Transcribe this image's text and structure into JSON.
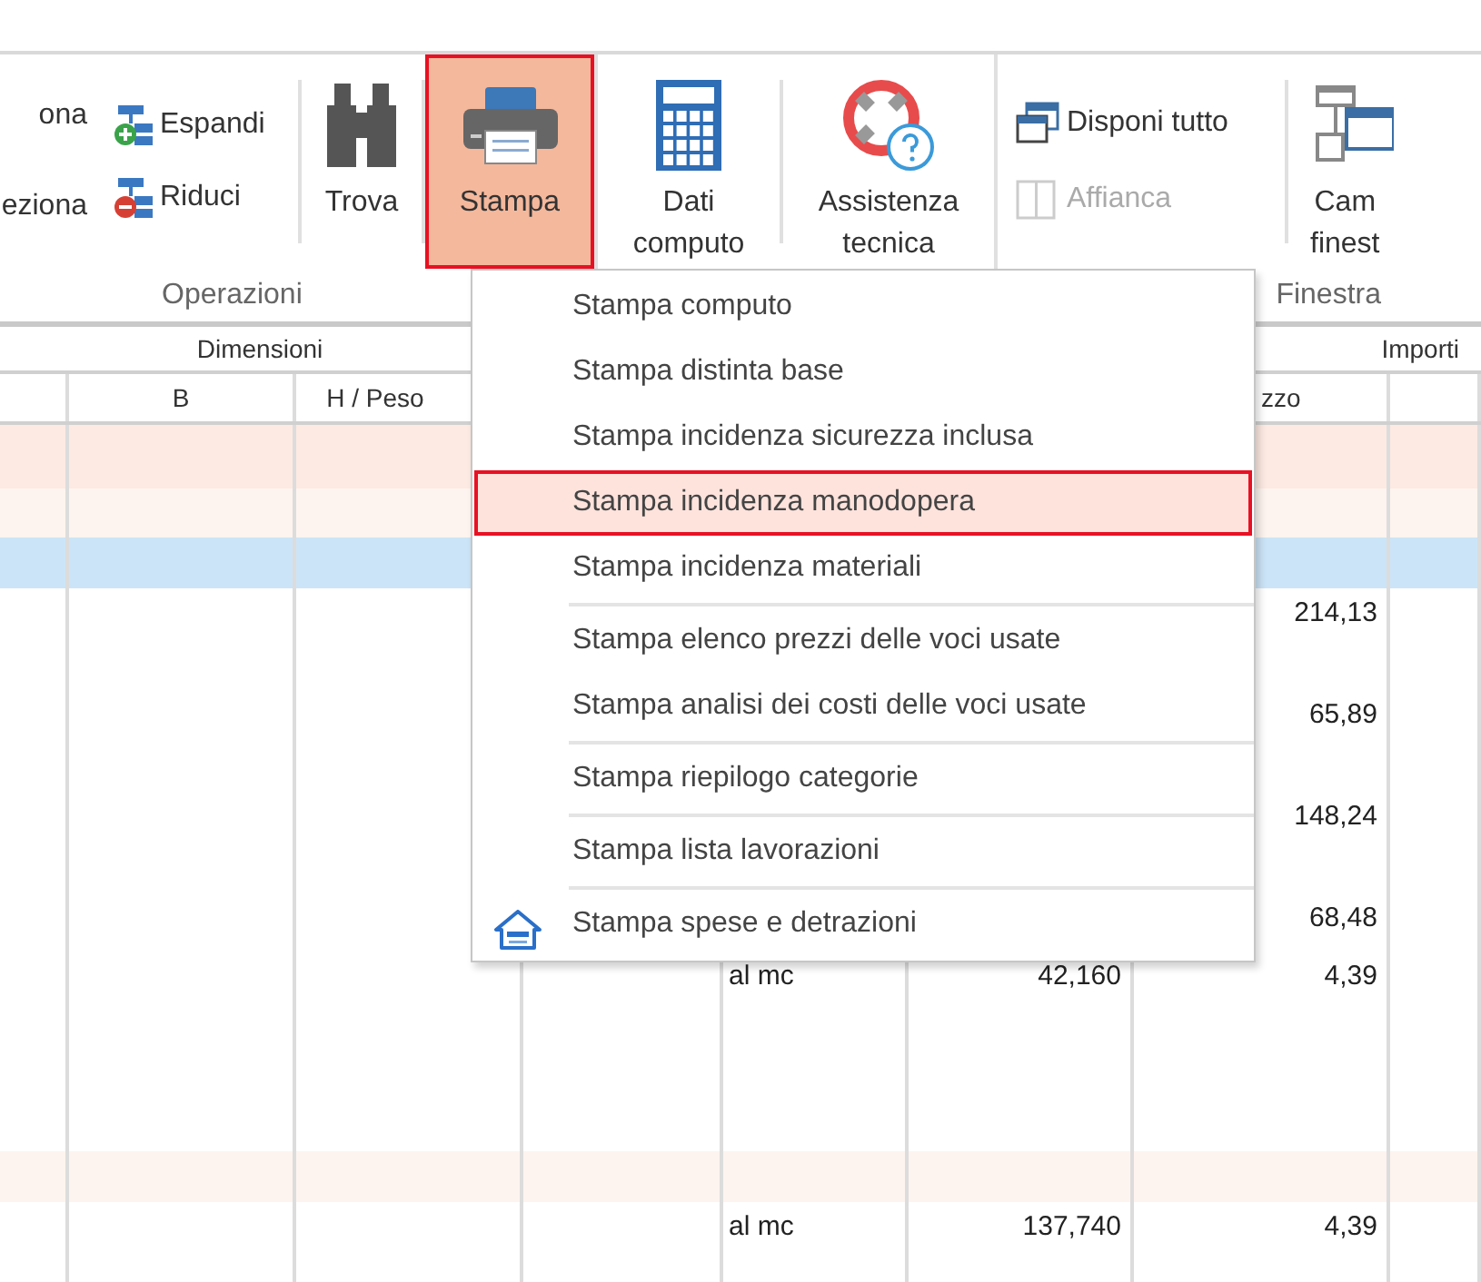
{
  "ribbon": {
    "cut_labels": [
      "ona",
      "eziona"
    ],
    "tree_buttons": [
      {
        "label": "Espandi"
      },
      {
        "label": "Riduci"
      }
    ],
    "large_buttons": [
      {
        "label": "Trova",
        "selected": false
      },
      {
        "label": "Stampa",
        "selected": true
      },
      {
        "label": "Dati\ncomputo",
        "selected": false
      },
      {
        "label": "Assistenza\ntecnica",
        "selected": false
      }
    ],
    "window_buttons": [
      {
        "label": "Disponi tutto",
        "disabled": false
      },
      {
        "label": "Affianca",
        "disabled": true
      }
    ],
    "cut_button": {
      "label": "Cam\nfinest"
    },
    "groups": [
      "Operazioni",
      "Finestra"
    ]
  },
  "table": {
    "group_headers": [
      "Dimensioni",
      "Importi"
    ],
    "column_headers": [
      "B",
      "H / Peso",
      "zzo"
    ],
    "rows": [
      {
        "color": "#fdeae3"
      },
      {
        "color": "#fef4ef"
      },
      {
        "color": "#cce4f7"
      },
      {
        "color": "#ffffff",
        "price": "214,13"
      },
      {
        "color": "#ffffff"
      },
      {
        "color": "#ffffff",
        "price": "65,89"
      },
      {
        "color": "#ffffff"
      },
      {
        "color": "#ffffff",
        "price": "148,24"
      },
      {
        "color": "#ffffff"
      },
      {
        "color": "#ffffff",
        "price": "68,48"
      },
      {
        "color": "#ffffff",
        "unit": "al mc",
        "quantity": "42,160",
        "price": "4,39"
      },
      {
        "color": "#ffffff"
      },
      {
        "color": "#ffffff"
      },
      {
        "color": "#ffffff"
      },
      {
        "color": "#fef4ef"
      },
      {
        "color": "#ffffff",
        "unit": "al mc",
        "quantity": "137,740",
        "price": "4,39"
      },
      {
        "color": "#ffffff"
      }
    ]
  },
  "print_menu": {
    "items": [
      {
        "kind": "plain",
        "label": "Stampa computo",
        "selected": false,
        "separator_before": false
      },
      {
        "kind": "plain",
        "label": "Stampa distinta base",
        "selected": false,
        "separator_before": false
      },
      {
        "kind": "plain",
        "label": "Stampa incidenza sicurezza inclusa",
        "selected": false,
        "separator_before": false
      },
      {
        "kind": "plain",
        "label": "Stampa incidenza manodopera",
        "selected": true,
        "separator_before": false
      },
      {
        "kind": "plain",
        "label": "Stampa incidenza materiali",
        "selected": false,
        "separator_before": false
      },
      {
        "kind": "plain",
        "label": "Stampa elenco prezzi delle voci usate",
        "selected": false,
        "separator_before": true
      },
      {
        "kind": "plain",
        "label": "Stampa analisi dei costi delle voci usate",
        "selected": false,
        "separator_before": false
      },
      {
        "kind": "plain",
        "label": "Stampa riepilogo categorie",
        "selected": false,
        "separator_before": true
      },
      {
        "kind": "plain",
        "label": "Stampa lista lavorazioni",
        "selected": false,
        "separator_before": true
      },
      {
        "kind": "with-icon",
        "label": "Stampa spese e detrazioni",
        "selected": false,
        "separator_before": true
      }
    ]
  }
}
